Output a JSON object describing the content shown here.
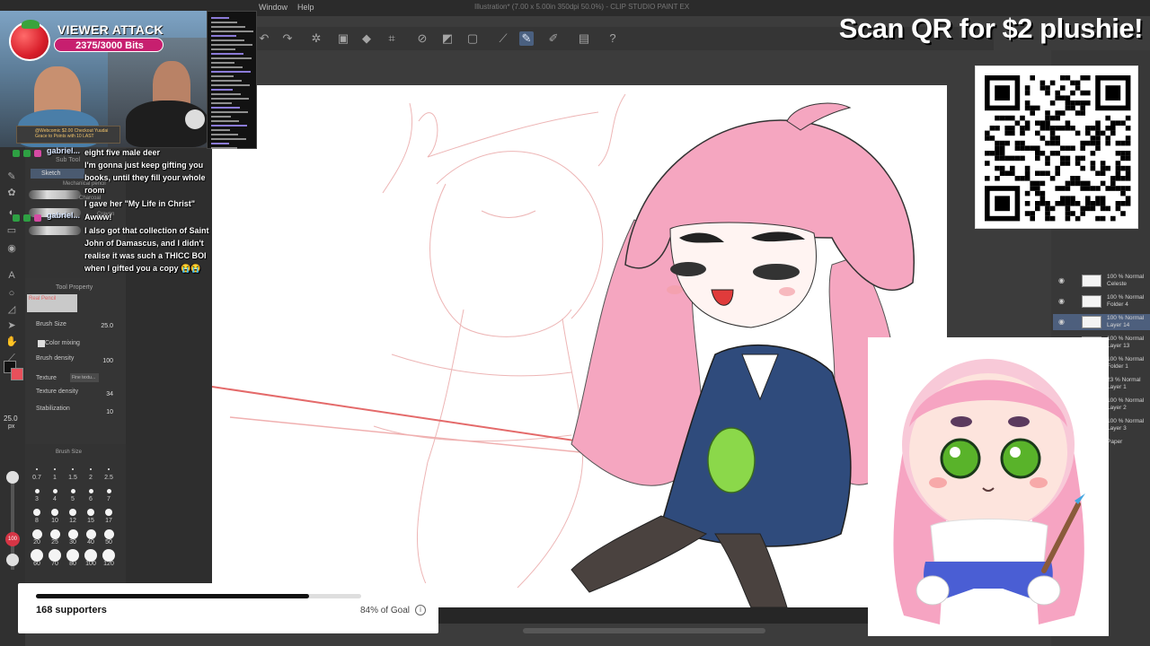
{
  "app": {
    "menu": [
      "Window",
      "Help"
    ],
    "title": "Illustration* (7.00 x 5.00in 350dpi 50.0%) - CLIP STUDIO PAINT EX"
  },
  "subtool": {
    "tab_label": "Sub Tool",
    "group_label": "Sketch",
    "brushes": [
      "Mechanical pencil",
      "Charcoal",
      "Crayon"
    ]
  },
  "tool_property": {
    "title": "Tool Property",
    "brush_name": "Real Pencil",
    "brush_size_label": "Brush Size",
    "brush_size_value": "25.0",
    "color_mixing_label": "Color mixing",
    "brush_density_label": "Brush density",
    "brush_density_value": "100",
    "texture_label": "Texture",
    "texture_value": "Fine textu...",
    "texture_density_label": "Texture density",
    "texture_density_value": "34",
    "stabilization_label": "Stabilization",
    "stabilization_value": "10"
  },
  "brush_size_palette": {
    "title": "Brush Size",
    "sizes": [
      "0.7",
      "1",
      "1.5",
      "2",
      "2.5",
      "3",
      "4",
      "5",
      "6",
      "7",
      "8",
      "10",
      "12",
      "15",
      "17",
      "20",
      "25",
      "30",
      "40",
      "50",
      "60",
      "70",
      "80",
      "100",
      "120"
    ]
  },
  "left_strip": {
    "size_readout": "25.0",
    "size_unit": "px",
    "slider_value": "100"
  },
  "overlay": {
    "viewer_attack": {
      "title": "VIEWER ATTACK",
      "bits": "2375/3000 Bits",
      "notification": "@Webcomic  $2.00 Checkout Yuudai Grace to Points with 10 LAST"
    },
    "chat": [
      {
        "user": "gabriel...",
        "text": "eight five male deer"
      },
      {
        "user": "",
        "text": "I'm gonna just keep gifting you books, until they fill your whole room"
      },
      {
        "user": "",
        "text": "I gave her \"My Life in Christ\""
      },
      {
        "user": "gabriel...",
        "text": "Awww!"
      },
      {
        "user": "",
        "text": "I also got that collection of Saint John of Damascus, and I didn't realise it was such a THICC BOI when I gifted you a copy 😭😭"
      }
    ],
    "qr_heading": "Scan QR for $2 plushie!",
    "goal": {
      "supporters": "168 supporters",
      "percent_label": "84% of Goal",
      "progress": 0.84,
      "info_icon": "i"
    }
  },
  "layers": [
    {
      "mode": "100 %",
      "name": "Celeste",
      "sub": "Normal"
    },
    {
      "mode": "100 %",
      "name": "Folder 4",
      "sub": "Normal"
    },
    {
      "mode": "100 %",
      "name": "Layer 14",
      "sub": "Normal",
      "selected": true
    },
    {
      "mode": "100 %",
      "name": "Layer 13",
      "sub": "Normal"
    },
    {
      "mode": "100 %",
      "name": "Folder 1",
      "sub": "Normal"
    },
    {
      "mode": "23 %",
      "name": "Layer 1",
      "sub": "Normal"
    },
    {
      "mode": "100 %",
      "name": "Layer 2",
      "sub": "Normal"
    },
    {
      "mode": "100 %",
      "name": "Layer 3",
      "sub": "Normal"
    },
    {
      "mode": "",
      "name": "Paper",
      "sub": ""
    }
  ],
  "colors": {
    "accent": "#c71f6f",
    "hair_pink": "#f5a6c0",
    "suit_navy": "#2f4b7c",
    "sketch_red": "#e06060"
  }
}
